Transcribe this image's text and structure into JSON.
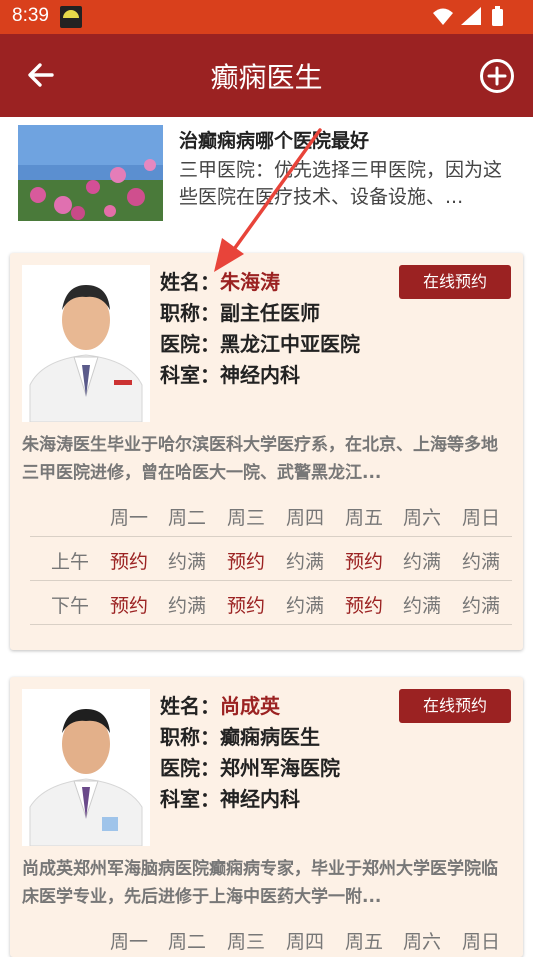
{
  "status_bar": {
    "time": "8:39",
    "icons": [
      "wifi-icon",
      "signal-icon",
      "battery-icon"
    ]
  },
  "app_bar": {
    "title": "癫痫医生",
    "back_icon": "back-arrow-icon",
    "add_icon": "add-circle-icon"
  },
  "article": {
    "title": "治癫痫病哪个医院最好",
    "desc": "三甲医院：优先选择三甲医院，因为这些医院在医疗技术、设备设施、..."
  },
  "labels": {
    "name": "姓名：",
    "title": "职称：",
    "hospital": "医院：",
    "dept": "科室：",
    "book_button": "在线预约"
  },
  "schedule_headers": {
    "days": [
      "周一",
      "周二",
      "周三",
      "周四",
      "周五",
      "周六",
      "周日"
    ],
    "am": "上午",
    "pm": "下午"
  },
  "doctors": [
    {
      "name": "朱海涛",
      "title": "副主任医师",
      "hospital": "黑龙江中亚医院",
      "dept": "神经内科",
      "bio": "朱海涛医生毕业于哈尔滨医科大学医疗系，在北京、上海等多地三甲医院进修，曾在哈医大一院、武警黑龙江...",
      "am": [
        "预约",
        "约满",
        "预约",
        "约满",
        "预约",
        "约满",
        "约满"
      ],
      "pm": [
        "预约",
        "约满",
        "预约",
        "约满",
        "预约",
        "约满",
        "约满"
      ]
    },
    {
      "name": "尚成英",
      "title": "癫痫病医生",
      "hospital": "郑州军海医院",
      "dept": "神经内科",
      "bio": "尚成英郑州军海脑病医院癫痫病专家，毕业于郑州大学医学院临床医学专业，先后进修于上海中医药大学一附...",
      "am": [],
      "pm": []
    }
  ],
  "colors": {
    "status_bar": "#d9401c",
    "app_bar": "#9b2222",
    "card_bg": "#fdf1e6",
    "accent": "#9b2222"
  }
}
